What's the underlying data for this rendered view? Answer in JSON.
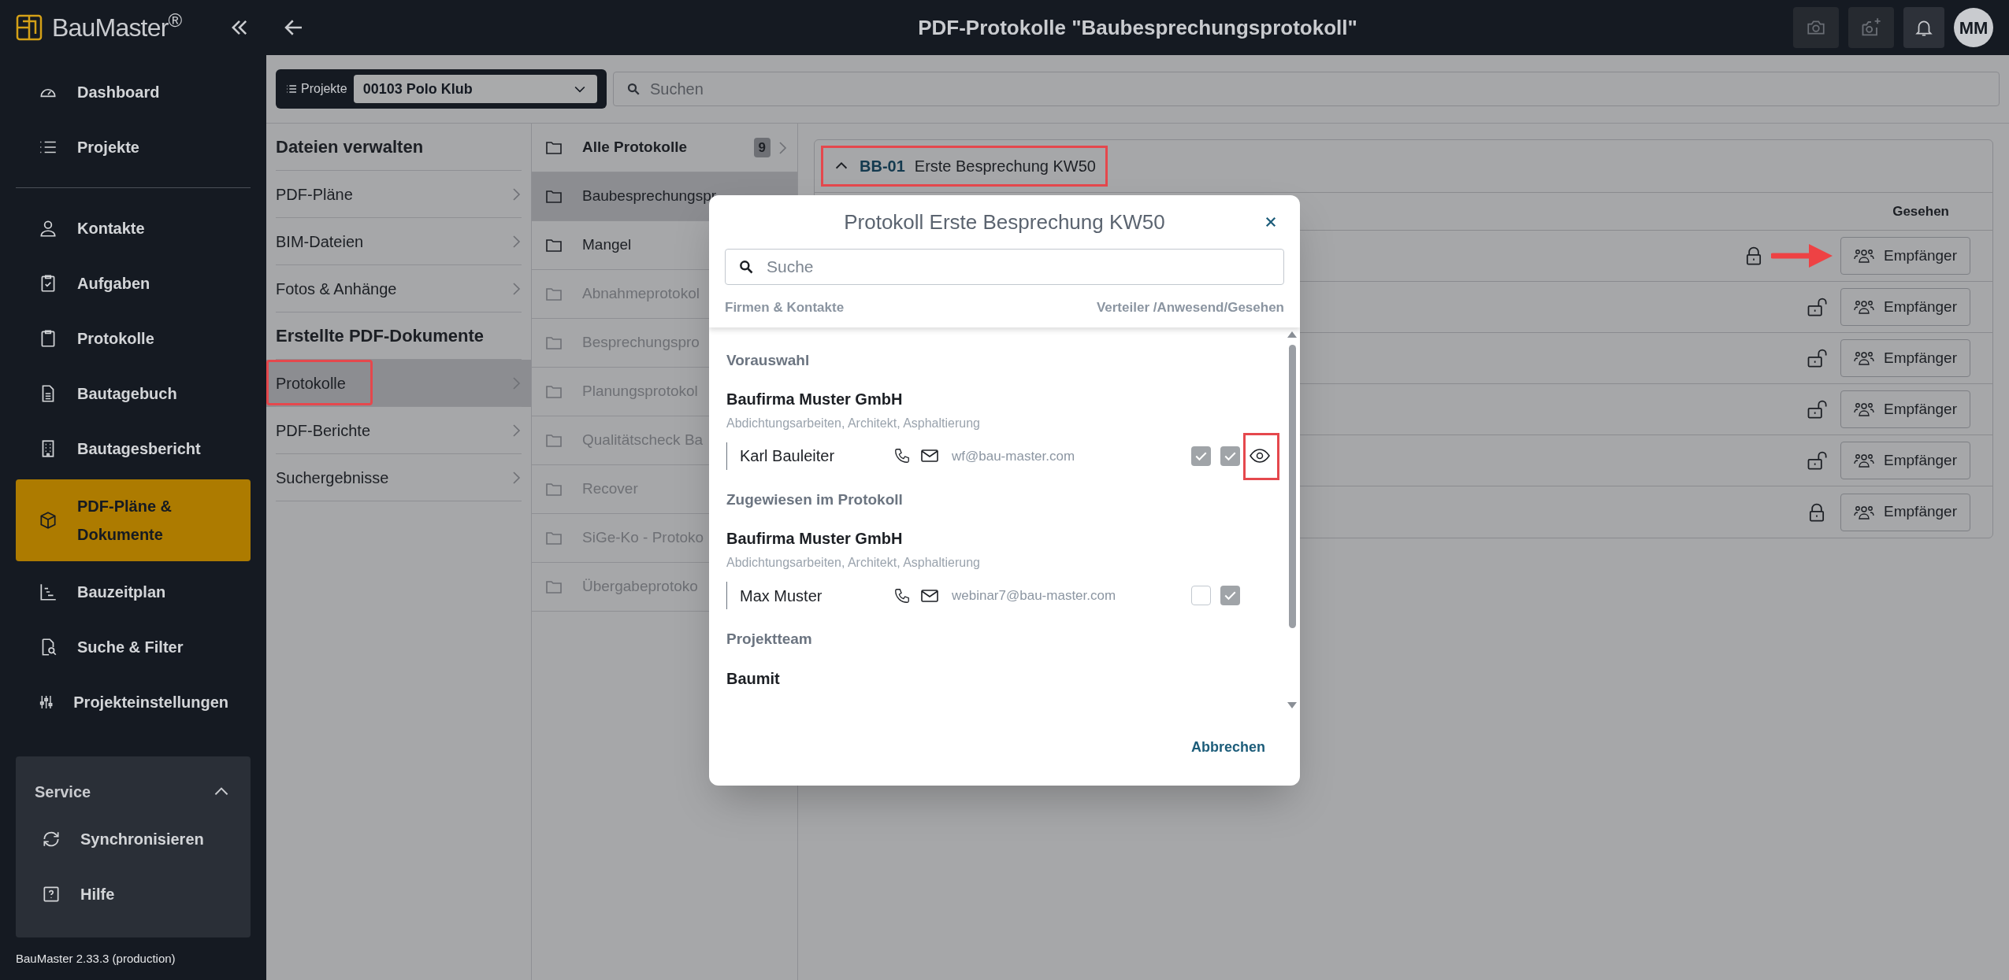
{
  "app": {
    "logo": "BauMaster$^{®}$",
    "version": "BauMaster 2.33.3 (production)"
  },
  "nav_top": [
    {
      "label": "Dashboard",
      "selected": false
    },
    {
      "label": "Projekte",
      "selected": false
    }
  ],
  "nav_main": [
    {
      "label": "Kontakte",
      "selected": false
    },
    {
      "label": "Aufgaben",
      "selected": false
    },
    {
      "label": "Protokolle",
      "selected": false
    },
    {
      "label": "Bautagebuch",
      "selected": false
    },
    {
      "label": "Bautagesbericht",
      "selected": false
    },
    {
      "label": "PDF-Pläne & Dokumente",
      "selected": true
    },
    {
      "label": "Bauzeitplan",
      "selected": false
    },
    {
      "label": "Suche & Filter",
      "selected": false
    },
    {
      "label": "Projekteinstellungen",
      "selected": false
    }
  ],
  "service": {
    "title": "Service",
    "expanded": true,
    "items": [
      {
        "label": "Synchronisieren"
      },
      {
        "label": "Hilfe"
      }
    ]
  },
  "topbar": {
    "title": "PDF-Protokolle \"Baubesprechungsprotokoll\"",
    "avatar": "MM"
  },
  "project_bar": {
    "label": "Projekte",
    "project": "00103 Polo Klub",
    "search_placeholder": "Suchen"
  },
  "files_menu": [
    {
      "kind": "heading",
      "label": "Dateien verwalten"
    },
    {
      "kind": "item",
      "label": "PDF-Pläne",
      "selected": false,
      "highlighted": false
    },
    {
      "kind": "item",
      "label": "BIM-Dateien",
      "selected": false,
      "highlighted": false
    },
    {
      "kind": "item",
      "label": "Fotos & Anhänge",
      "selected": false,
      "highlighted": false
    },
    {
      "kind": "heading",
      "label": "Erstellte PDF-Dokumente"
    },
    {
      "kind": "item",
      "label": "Protokolle",
      "selected": true,
      "highlighted": true
    },
    {
      "kind": "item",
      "label": "PDF-Berichte",
      "selected": false,
      "highlighted": false
    },
    {
      "kind": "item",
      "label": "Suchergebnisse",
      "selected": false,
      "highlighted": false
    }
  ],
  "folders": [
    {
      "label": "Alle Protokolle",
      "count": "9",
      "selected": false,
      "disabled": false
    },
    {
      "label": "Baubesprechungspr",
      "selected": true,
      "disabled": false
    },
    {
      "label": "Mangel",
      "selected": false,
      "disabled": false
    },
    {
      "label": "Abnahmeprotokol",
      "selected": false,
      "disabled": true
    },
    {
      "label": "Besprechungspro",
      "selected": false,
      "disabled": true
    },
    {
      "label": "Planungsprotokol",
      "selected": false,
      "disabled": true
    },
    {
      "label": "Qualitätscheck Ba",
      "selected": false,
      "disabled": true
    },
    {
      "label": "Recover",
      "selected": false,
      "disabled": true
    },
    {
      "label": "SiGe-Ko - Protoko",
      "selected": false,
      "disabled": true
    },
    {
      "label": "Übergabeprotoko",
      "selected": false,
      "disabled": true
    }
  ],
  "card": {
    "code": "BB-01",
    "title": "Erste Besprechung KW50",
    "expanded": true,
    "highlighted": true,
    "column_header": "Gesehen",
    "rows": [
      {
        "locked": true,
        "button": "Empfänger",
        "arrow": true
      },
      {
        "locked": false,
        "button": "Empfänger",
        "arrow": false
      },
      {
        "locked": false,
        "button": "Empfänger",
        "arrow": false
      },
      {
        "locked": false,
        "button": "Empfänger",
        "arrow": false
      },
      {
        "locked": false,
        "button": "Empfänger",
        "arrow": false
      },
      {
        "locked": true,
        "button": "Empfänger",
        "arrow": false
      }
    ]
  },
  "modal": {
    "title": "Protokoll Erste Besprechung KW50",
    "search_placeholder": "Suche",
    "column_left": "Firmen & Kontakte",
    "column_right": "Verteiler /Anwesend/Gesehen",
    "sections": [
      {
        "title": "Vorauswahl",
        "companies": [
          {
            "name": "Baufirma Muster GmbH",
            "trades": "Abdichtungsarbeiten, Architekt, Asphaltierung",
            "contacts": [
              {
                "name": "Karl Bauleiter",
                "email": "wf@bau-master.com",
                "verteiler": true,
                "anwesend": true,
                "gesehen": true,
                "highlighted": true
              }
            ]
          }
        ]
      },
      {
        "title": "Zugewiesen im Protokoll",
        "companies": [
          {
            "name": "Baufirma Muster GmbH",
            "trades": "Abdichtungsarbeiten, Architekt, Asphaltierung",
            "contacts": [
              {
                "name": "Max Muster",
                "email": "webinar7@bau-master.com",
                "verteiler": false,
                "anwesend": true,
                "gesehen": false,
                "highlighted": false
              }
            ]
          }
        ]
      },
      {
        "title": "Projektteam",
        "companies": [
          {
            "name": "Baumit"
          }
        ]
      }
    ],
    "cancel": "Abbrechen"
  }
}
